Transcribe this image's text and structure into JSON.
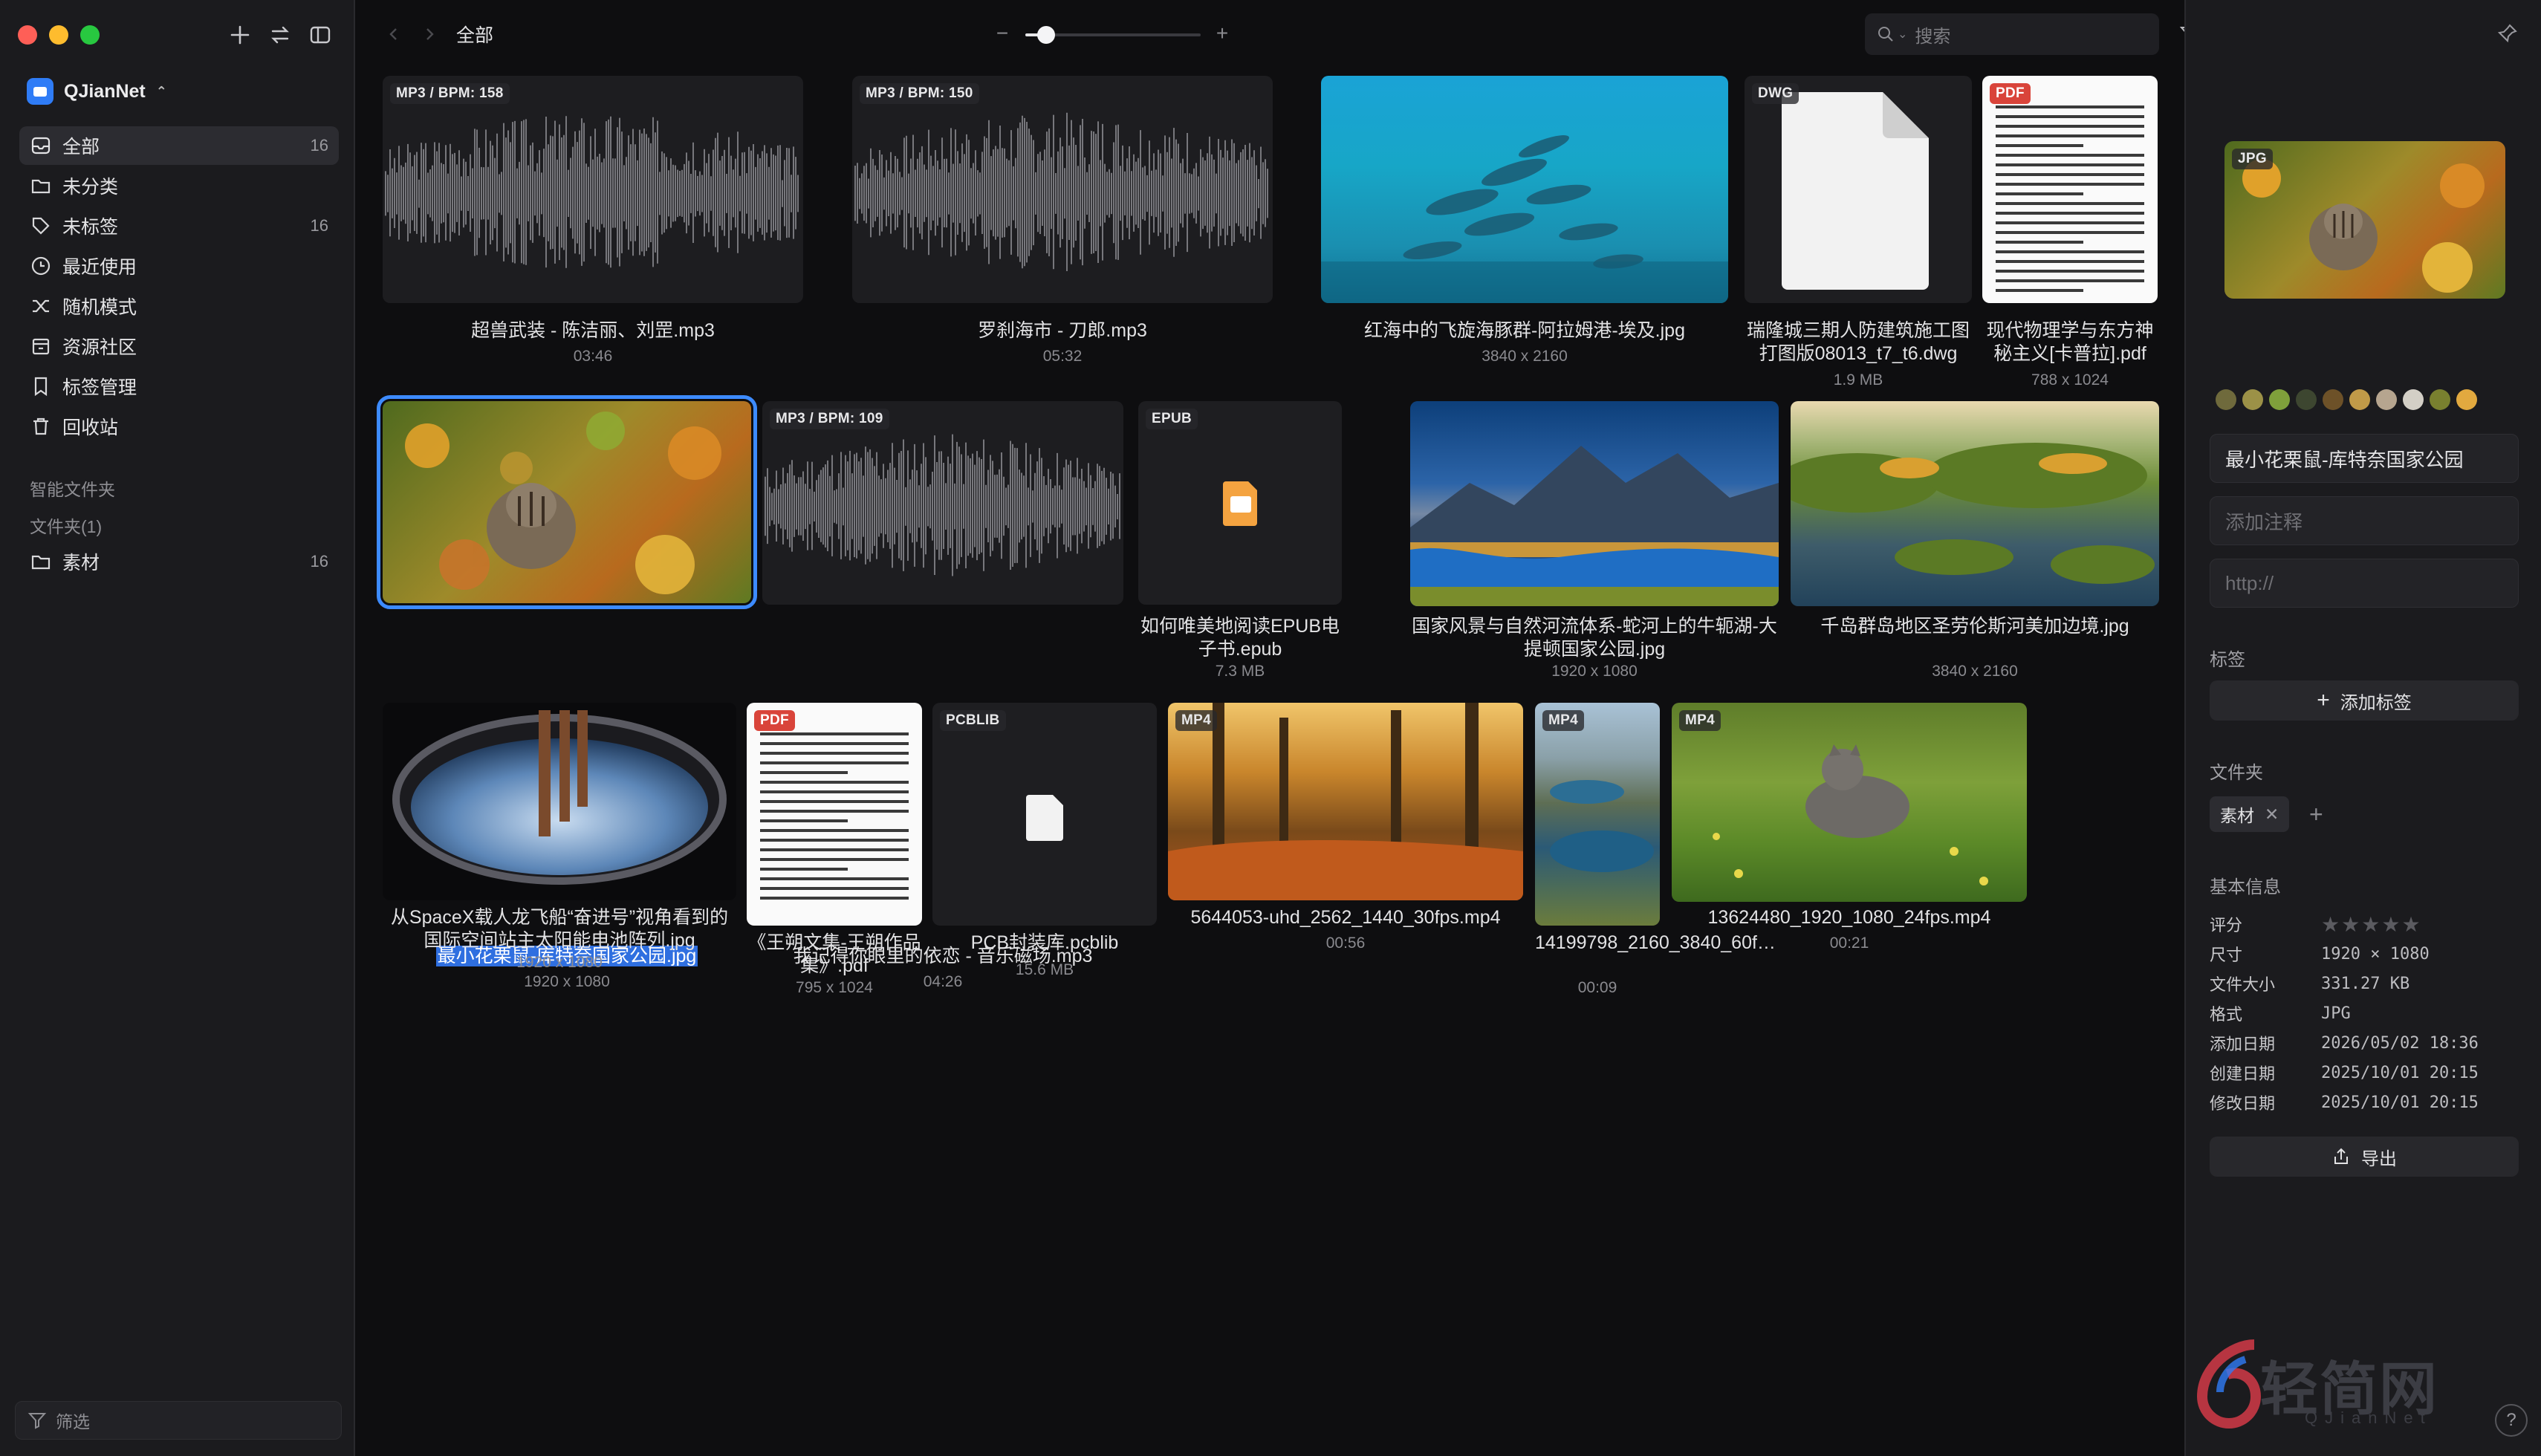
{
  "window": {
    "title": "全部"
  },
  "sidebar": {
    "library": "QJianNet",
    "items": [
      {
        "label": "全部",
        "count": "16"
      },
      {
        "label": "未分类",
        "count": ""
      },
      {
        "label": "未标签",
        "count": "16"
      },
      {
        "label": "最近使用",
        "count": ""
      },
      {
        "label": "随机模式",
        "count": ""
      },
      {
        "label": "资源社区",
        "count": ""
      },
      {
        "label": "标签管理",
        "count": ""
      },
      {
        "label": "回收站",
        "count": ""
      }
    ],
    "smart_folders": "智能文件夹",
    "folders_header": "文件夹(1)",
    "folder": {
      "label": "素材",
      "count": "16"
    },
    "filter_placeholder": "筛选"
  },
  "toolbar": {
    "search_placeholder": "搜索",
    "zoom": 0.12
  },
  "items": [
    {
      "name": "超兽武装 - 陈洁丽、刘罡.mp3",
      "meta": "03:46",
      "tag": "MP3 / BPM: 158"
    },
    {
      "name": "罗刹海市 - 刀郎.mp3",
      "meta": "05:32",
      "tag": "MP3 / BPM: 150"
    },
    {
      "name": "红海中的飞旋海豚群-阿拉姆港-埃及.jpg",
      "meta": "3840 x 2160",
      "tag": ""
    },
    {
      "name": "瑞隆城三期人防建筑施工图打图版08013_t7_t6.dwg",
      "meta": "1.9 MB",
      "tag": "DWG"
    },
    {
      "name": "现代物理学与东方神秘主义[卡普拉].pdf",
      "meta": "788 x 1024",
      "tag": "PDF"
    },
    {
      "name": "最小花栗鼠-库特奈国家公园.jpg",
      "meta": "1920 x 1080",
      "tag": ""
    },
    {
      "name": "我记得你眼里的依恋 - 音乐磁场.mp3",
      "meta": "04:26",
      "tag": "MP3 / BPM: 109"
    },
    {
      "name": "如何唯美地阅读EPUB电子书.epub",
      "meta": "7.3 MB",
      "tag": "EPUB"
    },
    {
      "name": "国家风景与自然河流体系-蛇河上的牛轭湖-大提顿国家公园.jpg",
      "meta": "1920 x 1080",
      "tag": ""
    },
    {
      "name": "千岛群岛地区圣劳伦斯河美加边境.jpg",
      "meta": "3840 x 2160",
      "tag": ""
    },
    {
      "name": "从SpaceX载人龙飞船“奋进号”视角看到的国际空间站主太阳能电池阵列.jpg",
      "meta": "1920 x 1080",
      "tag": ""
    },
    {
      "name": "《王朔文集-王朔作品集》.pdf",
      "meta": "795 x 1024",
      "tag": "PDF"
    },
    {
      "name": "PCB封装库.pcblib",
      "meta": "15.6 MB",
      "tag": "PCBLIB"
    },
    {
      "name": "5644053-uhd_2562_1440_30fps.mp4",
      "meta": "00:56",
      "tag": "MP4"
    },
    {
      "name": "14199798_2160_3840_60f…",
      "meta": "00:09",
      "tag": "MP4"
    },
    {
      "name": "13624480_1920_1080_24fps.mp4",
      "meta": "00:21",
      "tag": "MP4"
    }
  ],
  "inspector": {
    "preview_tag": "JPG",
    "colors": [
      "#6f6a3c",
      "#9c9147",
      "#7fa03b",
      "#3d4630",
      "#6d5128",
      "#c09a48",
      "#b6a58f",
      "#d3cfc6",
      "#79802f",
      "#e2a93f"
    ],
    "title": "最小花栗鼠-库特奈国家公园",
    "note_placeholder": "添加注释",
    "url_placeholder": "http://",
    "tags_label": "标签",
    "add_tag": "添加标签",
    "folder_label": "文件夹",
    "folder_chip": "素材",
    "basic_info": "基本信息",
    "rows": [
      {
        "k": "评分",
        "v": ""
      },
      {
        "k": "尺寸",
        "v": "1920 × 1080"
      },
      {
        "k": "文件大小",
        "v": "331.27 KB"
      },
      {
        "k": "格式",
        "v": "JPG"
      },
      {
        "k": "添加日期",
        "v": "2026/05/02 18:36"
      },
      {
        "k": "创建日期",
        "v": "2025/10/01 20:15"
      },
      {
        "k": "修改日期",
        "v": "2025/10/01 20:15"
      }
    ],
    "export": "导出",
    "watermark": "轻简网",
    "watermark_sub": "QJianNet"
  }
}
